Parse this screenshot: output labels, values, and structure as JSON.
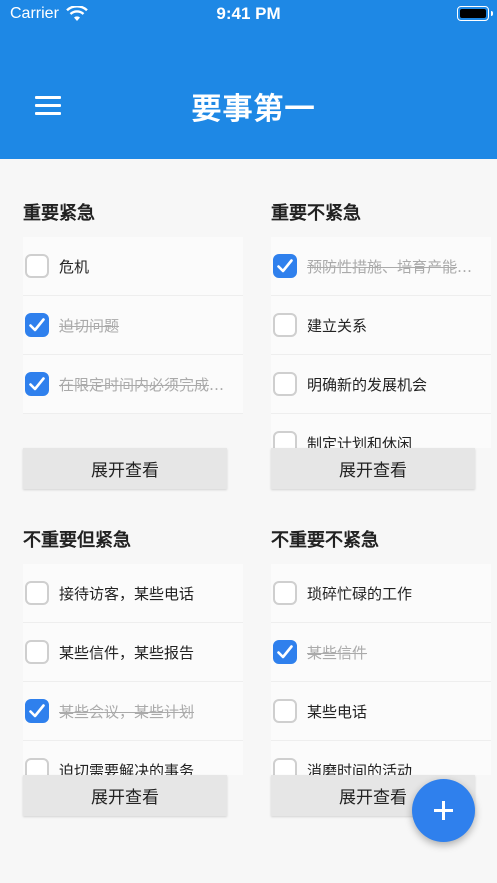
{
  "status_bar": {
    "carrier": "Carrier",
    "time": "9:41 PM"
  },
  "header": {
    "title": "要事第一",
    "menu_icon": "hamburger-menu-icon"
  },
  "accent_color": "#2f80ed",
  "header_color": "#1e88e5",
  "quadrants": [
    {
      "title": "重要紧急",
      "expand_label": "展开查看",
      "items": [
        {
          "text": "危机",
          "done": false
        },
        {
          "text": "迫切问题",
          "done": true
        },
        {
          "text": "在限定时间内必须完成的任务",
          "done": true
        }
      ]
    },
    {
      "title": "重要不紧急",
      "expand_label": "展开查看",
      "items": [
        {
          "text": "预防性措施、培育产能的活动",
          "done": true
        },
        {
          "text": "建立关系",
          "done": false
        },
        {
          "text": "明确新的发展机会",
          "done": false
        },
        {
          "text": "制定计划和休闲",
          "done": false
        }
      ]
    },
    {
      "title": "不重要但紧急",
      "expand_label": "展开查看",
      "items": [
        {
          "text": "接待访客，某些电话",
          "done": false
        },
        {
          "text": "某些信件，某些报告",
          "done": false
        },
        {
          "text": "某些会议，某些计划",
          "done": true
        },
        {
          "text": "迫切需要解决的事务",
          "done": false
        }
      ]
    },
    {
      "title": "不重要不紧急",
      "expand_label": "展开查看",
      "items": [
        {
          "text": "琐碎忙碌的工作",
          "done": false
        },
        {
          "text": "某些信件",
          "done": true
        },
        {
          "text": "某些电话",
          "done": false
        },
        {
          "text": "消磨时间的活动",
          "done": false
        }
      ]
    }
  ],
  "fab": {
    "icon": "plus-icon"
  }
}
